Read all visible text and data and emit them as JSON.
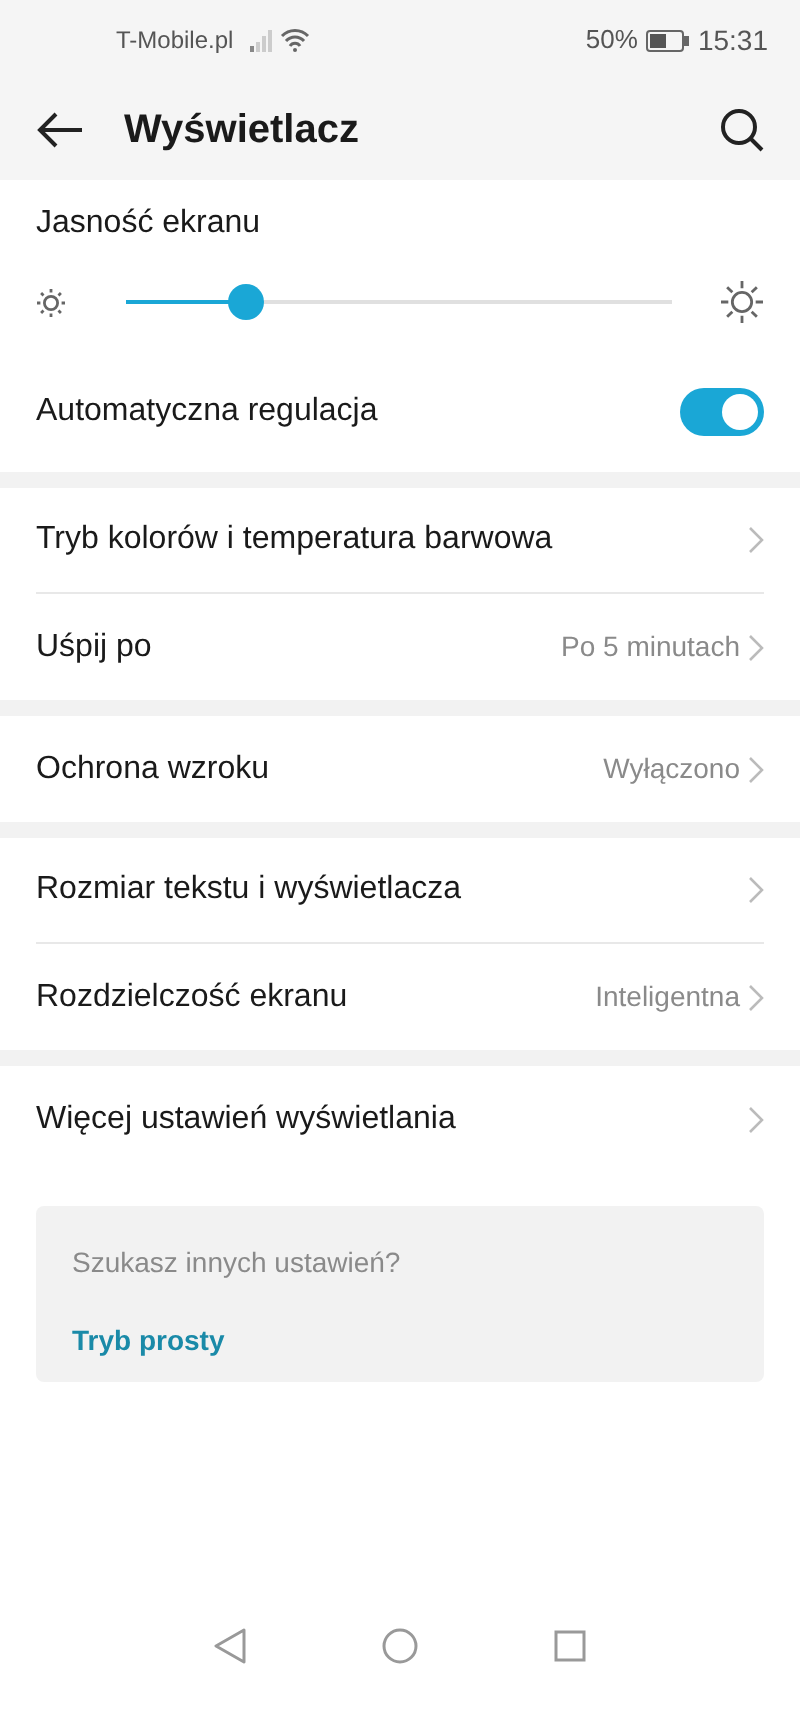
{
  "status_bar": {
    "carrier": "T-Mobile.pl",
    "battery": "50%",
    "time": "15:31"
  },
  "header": {
    "title": "Wyświetlacz"
  },
  "brightness": {
    "label": "Jasność ekranu",
    "level": 0.22,
    "auto_label": "Automatyczna regulacja",
    "auto_on": true
  },
  "groups": [
    [
      {
        "label": "Tryb kolorów i temperatura barwowa"
      },
      {
        "label": "Uśpij po",
        "value": "Po 5 minutach"
      }
    ],
    [
      {
        "label": "Ochrona wzroku",
        "value": "Wyłączono"
      }
    ],
    [
      {
        "label": "Rozmiar tekstu i wyświetlacza"
      },
      {
        "label": "Rozdzielczość ekranu",
        "value": "Inteligentna"
      }
    ],
    [
      {
        "label": "Więcej ustawień wyświetlania"
      }
    ]
  ],
  "suggestion": {
    "question": "Szukasz innych ustawień?",
    "link": "Tryb prosty"
  }
}
